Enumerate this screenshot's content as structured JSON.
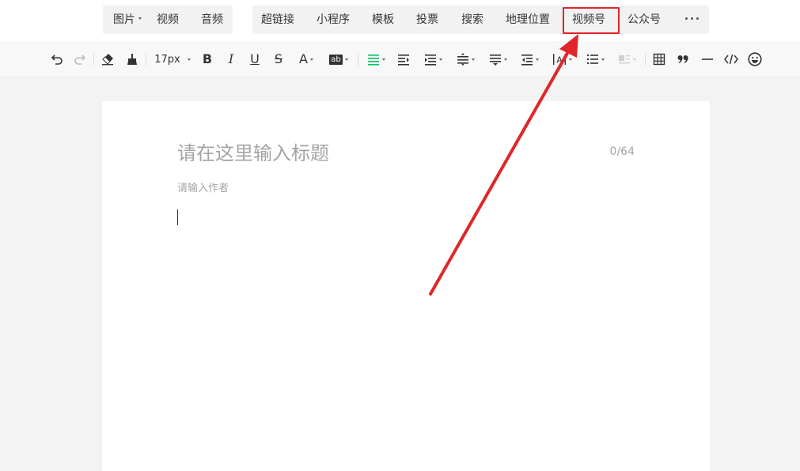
{
  "insert_bar": {
    "media": [
      {
        "label": "图片",
        "has_caret": true
      },
      {
        "label": "视频"
      },
      {
        "label": "音频"
      }
    ],
    "insert": [
      {
        "label": "超链接"
      },
      {
        "label": "小程序"
      },
      {
        "label": "模板"
      },
      {
        "label": "投票"
      },
      {
        "label": "搜索"
      },
      {
        "label": "地理位置"
      },
      {
        "label": "视频号",
        "highlighted": true
      },
      {
        "label": "公众号"
      }
    ],
    "more_icon": "ellipsis-icon"
  },
  "format_bar": {
    "font_size": "17px",
    "bold": "B",
    "italic": "I",
    "underline": "U",
    "strike": "S",
    "font_color": "A",
    "bg_color": "ab",
    "active_align_color": "#07c160"
  },
  "editor": {
    "title_placeholder": "请在这里输入标题",
    "title_count": "0/64",
    "author_placeholder": "请输入作者"
  },
  "annotation": {
    "color": "#e0262a"
  }
}
